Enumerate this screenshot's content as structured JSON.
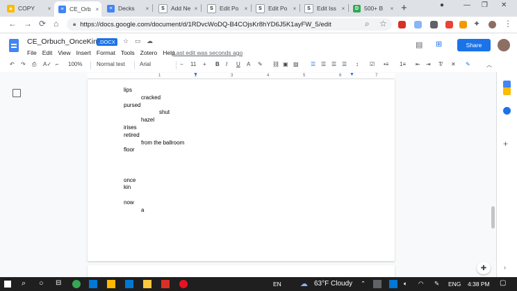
{
  "browser": {
    "tabs": [
      {
        "title": "COPY",
        "color": "#fbbc04",
        "glyph": "▲"
      },
      {
        "title": "CE_Orb",
        "color": "#4285f4",
        "glyph": "≡",
        "active": true
      },
      {
        "title": "Decks",
        "color": "#4285f4",
        "glyph": "≡"
      },
      {
        "title": "Add Ne",
        "color": "#ffffff",
        "glyph": "S"
      },
      {
        "title": "Edit Po",
        "color": "#ffffff",
        "glyph": "S"
      },
      {
        "title": "Edit Po",
        "color": "#ffffff",
        "glyph": "S"
      },
      {
        "title": "Edit Iss",
        "color": "#ffffff",
        "glyph": "S"
      },
      {
        "title": "500+ B",
        "color": "#34a853",
        "glyph": "D"
      }
    ],
    "close_glyph": "×",
    "new_tab_glyph": "+",
    "url": "https://docs.google.com/document/d/1RDvcWoDQ-B4COjsKr8hYD6J5K1ayFW_5/edit"
  },
  "doc": {
    "title": "CE_Orbuch_OnceKin",
    "badge": ".DOCX",
    "menu": [
      "File",
      "Edit",
      "View",
      "Insert",
      "Format",
      "Tools",
      "Zotero",
      "Help"
    ],
    "last_edit": "Last edit was seconds ago",
    "share_label": "Share"
  },
  "toolbar": {
    "zoom": "100%",
    "style": "Normal text",
    "font": "Arial",
    "font_size": "11"
  },
  "ruler": {
    "ticks": [
      "1",
      "2",
      "3",
      "4",
      "5",
      "6",
      "7"
    ]
  },
  "content": {
    "lines": [
      {
        "text": "lips",
        "indent": 0
      },
      {
        "text": "cracked",
        "indent": 1
      },
      {
        "text": "pursed",
        "indent": 0
      },
      {
        "text": "shut",
        "indent": 2
      },
      {
        "text": "hazel",
        "indent": 1
      },
      {
        "text": "irises",
        "indent": 0
      },
      {
        "text": "retired",
        "indent": 0
      },
      {
        "text": "from the ballroom",
        "indent": 1
      },
      {
        "text": "floor",
        "indent": 0
      },
      {
        "text": "",
        "indent": 0
      },
      {
        "text": "",
        "indent": 0
      },
      {
        "text": "",
        "indent": 0
      },
      {
        "text": "once",
        "indent": 0
      },
      {
        "text": "kin",
        "indent": 0
      },
      {
        "text": "",
        "indent": 0
      },
      {
        "text": "now",
        "indent": 0
      },
      {
        "text": "a",
        "indent": 1
      }
    ]
  },
  "taskbar": {
    "language_short": "EN",
    "weather": "63°F  Cloudy",
    "language": "ENG",
    "time": "4:38 PM"
  }
}
